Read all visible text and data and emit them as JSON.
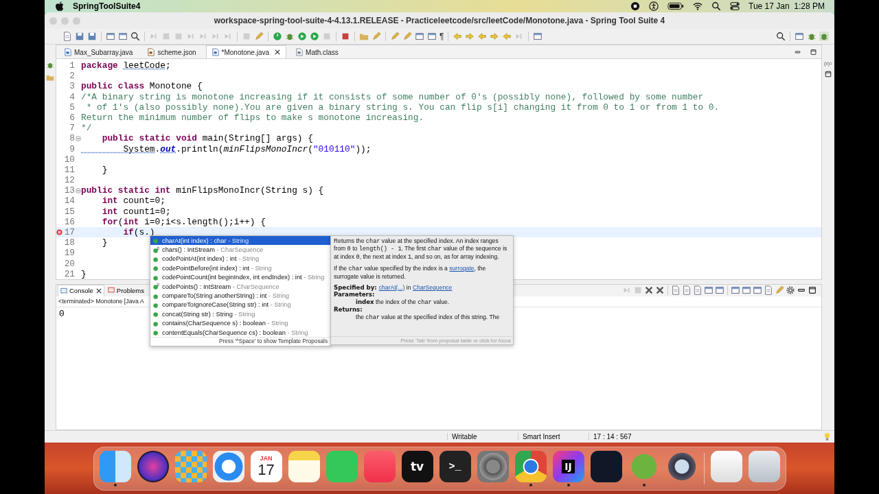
{
  "menu_bar": {
    "app_name": "SpringToolSuite4",
    "clock": "Tue 17 Jan  1:28 PM"
  },
  "window": {
    "title": "workspace-spring-tool-suite-4-4.13.1.RELEASE - Practiceleetcode/src/leetCode/Monotone.java - Spring Tool Suite 4"
  },
  "toolbar": {
    "glyph": "¶"
  },
  "side_trim": {
    "variables_label": "(x)="
  },
  "editor_tabs": [
    {
      "label": "Max_Subarray.java",
      "kind": "java",
      "selected": false
    },
    {
      "label": "scheme.json",
      "kind": "json",
      "selected": false
    },
    {
      "label": "*Monotone.java",
      "kind": "java",
      "selected": true
    },
    {
      "label": "Math.class",
      "kind": "class",
      "selected": false
    }
  ],
  "editor": {
    "lines": [
      {
        "number": "1",
        "foldable": false,
        "error": false,
        "current": false,
        "segments": [
          {
            "kind": "kw",
            "text": "package "
          },
          {
            "kind": "warn",
            "text": "leetCode"
          },
          {
            "kind": "plain",
            "text": ";"
          }
        ]
      },
      {
        "number": "2",
        "foldable": false,
        "error": false,
        "current": false
      },
      {
        "number": "3",
        "foldable": false,
        "error": false,
        "current": false,
        "segments": [
          {
            "kind": "kw",
            "text": "public class"
          },
          {
            "kind": "plain",
            "text": " Monotone {"
          }
        ]
      },
      {
        "number": "4",
        "foldable": false,
        "error": false,
        "current": false,
        "segments": [
          {
            "kind": "comment",
            "text": "/*A binary string is monotone increasing if it consists of some number of 0's (possibly none), followed by some number"
          }
        ]
      },
      {
        "number": "5",
        "foldable": false,
        "error": false,
        "current": false,
        "segments": [
          {
            "kind": "comment",
            "text": " * of 1's (also possibly none).You are given a binary string s. You can flip s[i] changing it from 0 to 1 or from 1 to 0."
          }
        ]
      },
      {
        "number": "6",
        "foldable": false,
        "error": false,
        "current": false,
        "segments": [
          {
            "kind": "comment",
            "text": "Return the minimum number of flips to make s monotone increasing."
          }
        ]
      },
      {
        "number": "7",
        "foldable": false,
        "error": false,
        "current": false,
        "segments": [
          {
            "kind": "comment",
            "text": "*/"
          }
        ]
      },
      {
        "number": "8",
        "foldable": true,
        "error": false,
        "current": false,
        "segments": [
          {
            "kind": "kw",
            "text": "    public static void"
          },
          {
            "kind": "plain",
            "text": " main(String[] args) {"
          }
        ]
      },
      {
        "number": "9",
        "foldable": false,
        "error": false,
        "current": false,
        "segments": [
          {
            "kind": "warn",
            "text": "        System"
          },
          {
            "kind": "plain",
            "text": "."
          },
          {
            "kind": "field",
            "text": "out"
          },
          {
            "kind": "plain",
            "text": ".println("
          },
          {
            "kind": "call",
            "text": "minFlipsMonoIncr"
          },
          {
            "kind": "plain",
            "text": "("
          },
          {
            "kind": "string",
            "text": "\"010110\""
          },
          {
            "kind": "plain",
            "text": "));"
          }
        ]
      },
      {
        "number": "10",
        "foldable": false,
        "error": false,
        "current": false
      },
      {
        "number": "11",
        "foldable": false,
        "error": false,
        "current": false,
        "segments": [
          {
            "kind": "plain",
            "text": "    }"
          }
        ]
      },
      {
        "number": "12",
        "foldable": false,
        "error": false,
        "current": false
      },
      {
        "number": "13",
        "foldable": true,
        "error": false,
        "current": false,
        "segments": [
          {
            "kind": "kw",
            "text": "public static int"
          },
          {
            "kind": "plain",
            "text": " minFlipsMonoIncr(String s) {"
          }
        ]
      },
      {
        "number": "14",
        "foldable": false,
        "error": false,
        "current": false,
        "segments": [
          {
            "kind": "kw",
            "text": "    int"
          },
          {
            "kind": "plain",
            "text": " count=0;"
          }
        ]
      },
      {
        "number": "15",
        "foldable": false,
        "error": false,
        "current": false,
        "segments": [
          {
            "kind": "kw",
            "text": "    int"
          },
          {
            "kind": "plain",
            "text": " count1=0;"
          }
        ]
      },
      {
        "number": "16",
        "foldable": false,
        "error": false,
        "current": false,
        "segments": [
          {
            "kind": "kw",
            "text": "    for"
          },
          {
            "kind": "plain",
            "text": "("
          },
          {
            "kind": "kw",
            "text": "int"
          },
          {
            "kind": "plain",
            "text": " i=0;i<s.length();i++) {"
          }
        ]
      },
      {
        "number": "17",
        "foldable": false,
        "error": true,
        "current": true,
        "segments": [
          {
            "kind": "kw",
            "text": "        if"
          },
          {
            "kind": "plain",
            "text": "(s.)"
          }
        ]
      },
      {
        "number": "18",
        "foldable": false,
        "error": false,
        "current": false,
        "segments": [
          {
            "kind": "plain",
            "text": "    }"
          }
        ]
      },
      {
        "number": "19",
        "foldable": false,
        "error": false,
        "current": false
      },
      {
        "number": "20",
        "foldable": false,
        "error": false,
        "current": false
      },
      {
        "number": "21",
        "foldable": false,
        "error": false,
        "current": false,
        "segments": [
          {
            "kind": "plain",
            "text": "}"
          }
        ]
      }
    ]
  },
  "completion": {
    "items": [
      {
        "signature": "charAt(int index) : char",
        "owner": "- String",
        "default": false,
        "selected": true
      },
      {
        "signature": "chars() : IntStream",
        "owner": "- CharSequence",
        "default": true,
        "selected": false
      },
      {
        "signature": "codePointAt(int index) : int",
        "owner": "- String",
        "default": false,
        "selected": false
      },
      {
        "signature": "codePointBefore(int index) : int",
        "owner": "- String",
        "default": false,
        "selected": false
      },
      {
        "signature": "codePointCount(int beginIndex, int endIndex) : int",
        "owner": "- String",
        "default": false,
        "selected": false
      },
      {
        "signature": "codePoints() : IntStream",
        "owner": "- CharSequence",
        "default": true,
        "selected": false
      },
      {
        "signature": "compareTo(String anotherString) : int",
        "owner": "- String",
        "default": false,
        "selected": false
      },
      {
        "signature": "compareToIgnoreCase(String str) : int",
        "owner": "- String",
        "default": false,
        "selected": false
      },
      {
        "signature": "concat(String str) : String",
        "owner": "- String",
        "default": false,
        "selected": false
      },
      {
        "signature": "contains(CharSequence s) : boolean",
        "owner": "- String",
        "default": false,
        "selected": false
      },
      {
        "signature": "contentEquals(CharSequence cs) : boolean",
        "owner": "- String",
        "default": false,
        "selected": false
      }
    ],
    "hint": "Press '^Space' to show Template Proposals"
  },
  "javadoc": {
    "blocks": [
      {
        "kind": "text",
        "segments": [
          {
            "kind": "plain",
            "text": "Returns the "
          },
          {
            "kind": "code",
            "text": "char"
          },
          {
            "kind": "plain",
            "text": " value at the specified index. An index ranges from "
          },
          {
            "kind": "code",
            "text": "0"
          },
          {
            "kind": "plain",
            "text": " to "
          },
          {
            "kind": "code",
            "text": "length() - 1"
          },
          {
            "kind": "plain",
            "text": ". The first "
          },
          {
            "kind": "code",
            "text": "char"
          },
          {
            "kind": "plain",
            "text": " value of the sequence is at index "
          },
          {
            "kind": "code",
            "text": "0"
          },
          {
            "kind": "plain",
            "text": ", the next at index "
          },
          {
            "kind": "code",
            "text": "1"
          },
          {
            "kind": "plain",
            "text": ", and so on, as for array indexing."
          }
        ]
      },
      {
        "kind": "text",
        "segments": [
          {
            "kind": "plain",
            "text": "If the "
          },
          {
            "kind": "code",
            "text": "char"
          },
          {
            "kind": "plain",
            "text": " value specified by the index is a "
          },
          {
            "kind": "link",
            "text": "surrogate"
          },
          {
            "kind": "plain",
            "text": ", the surrogate value is returned."
          }
        ]
      },
      {
        "kind": "tight",
        "segments": [
          {
            "kind": "bold",
            "text": "Specified by: "
          },
          {
            "kind": "link",
            "text": "charAt(...)"
          },
          {
            "kind": "plain",
            "text": " in "
          },
          {
            "kind": "link",
            "text": "CharSequence"
          }
        ]
      },
      {
        "kind": "heading",
        "segments": [
          {
            "kind": "plain",
            "text": "Parameters:"
          }
        ]
      },
      {
        "kind": "indented",
        "segments": [
          {
            "kind": "bold",
            "text": "index"
          },
          {
            "kind": "plain",
            "text": " the index of the "
          },
          {
            "kind": "code",
            "text": "char"
          },
          {
            "kind": "plain",
            "text": " value."
          }
        ]
      },
      {
        "kind": "heading",
        "segments": [
          {
            "kind": "plain",
            "text": "Returns:"
          }
        ]
      },
      {
        "kind": "indented",
        "segments": [
          {
            "kind": "plain",
            "text": "the "
          },
          {
            "kind": "code",
            "text": "char"
          },
          {
            "kind": "plain",
            "text": " value at the specified index of this string. The"
          }
        ]
      }
    ],
    "hint": "Press 'Tab' from proposal table or click for focus"
  },
  "bottom_tabs": [
    {
      "label": "Console",
      "selected": true
    },
    {
      "label": "Problems",
      "selected": false
    }
  ],
  "console": {
    "header": "<terminated> Monotone [Java A",
    "output": "0"
  },
  "status_bar": [
    "Writable",
    "Smart Insert",
    "17 : 14 : 567"
  ],
  "dock": [
    {
      "kind": "finder",
      "running": true
    },
    {
      "kind": "siri",
      "running": false
    },
    {
      "kind": "launchpad",
      "running": false
    },
    {
      "kind": "safari",
      "running": false
    },
    {
      "kind": "calendar",
      "month": "JAN",
      "day": "17",
      "running": false
    },
    {
      "kind": "notes",
      "running": false
    },
    {
      "kind": "facetime",
      "running": false
    },
    {
      "kind": "music",
      "running": false
    },
    {
      "kind": "tv",
      "label": "tv",
      "running": false
    },
    {
      "kind": "terminal",
      "label": ">_",
      "running": false
    },
    {
      "kind": "settings",
      "running": false
    },
    {
      "kind": "chrome",
      "running": true
    },
    {
      "kind": "intellij",
      "label": "IJ",
      "running": true
    },
    {
      "kind": "wave",
      "running": false
    },
    {
      "kind": "spring",
      "running": true
    },
    {
      "kind": "quicktime",
      "running": false
    },
    {
      "kind": "separator"
    },
    {
      "kind": "preview",
      "running": false
    },
    {
      "kind": "trash",
      "running": false
    }
  ]
}
